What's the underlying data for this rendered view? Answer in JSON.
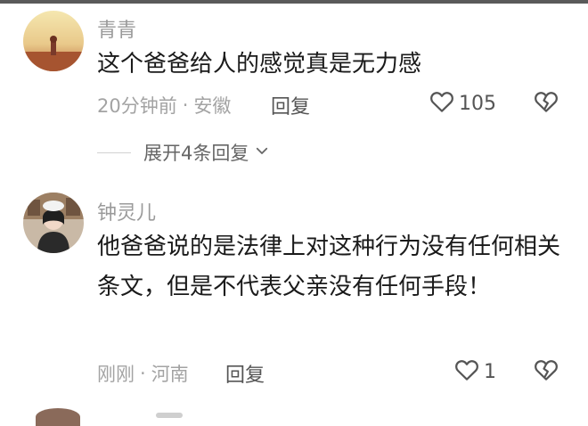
{
  "comments": [
    {
      "username": "青青",
      "text": "这个爸爸给人的感觉真是无力感",
      "time": "20分钟前",
      "separator": "·",
      "location": "安徽",
      "reply_label": "回复",
      "like_count": "105",
      "replies_expand_label": "展开4条回复"
    },
    {
      "username": "钟灵儿",
      "text": "他爸爸说的是法律上对这种行为没有任何相关条文，但是不代表父亲没有任何手段！",
      "time": "刚刚",
      "separator": "·",
      "location": "河南",
      "reply_label": "回复",
      "like_count": "1"
    }
  ],
  "icons": {
    "like": "heart-outline-icon",
    "dislike": "broken-heart-icon",
    "expand": "chevron-down-icon"
  },
  "colors": {
    "username": "#9a9a9a",
    "text": "#1a1a1a",
    "meta": "#a3a3a3",
    "action": "#555555"
  }
}
